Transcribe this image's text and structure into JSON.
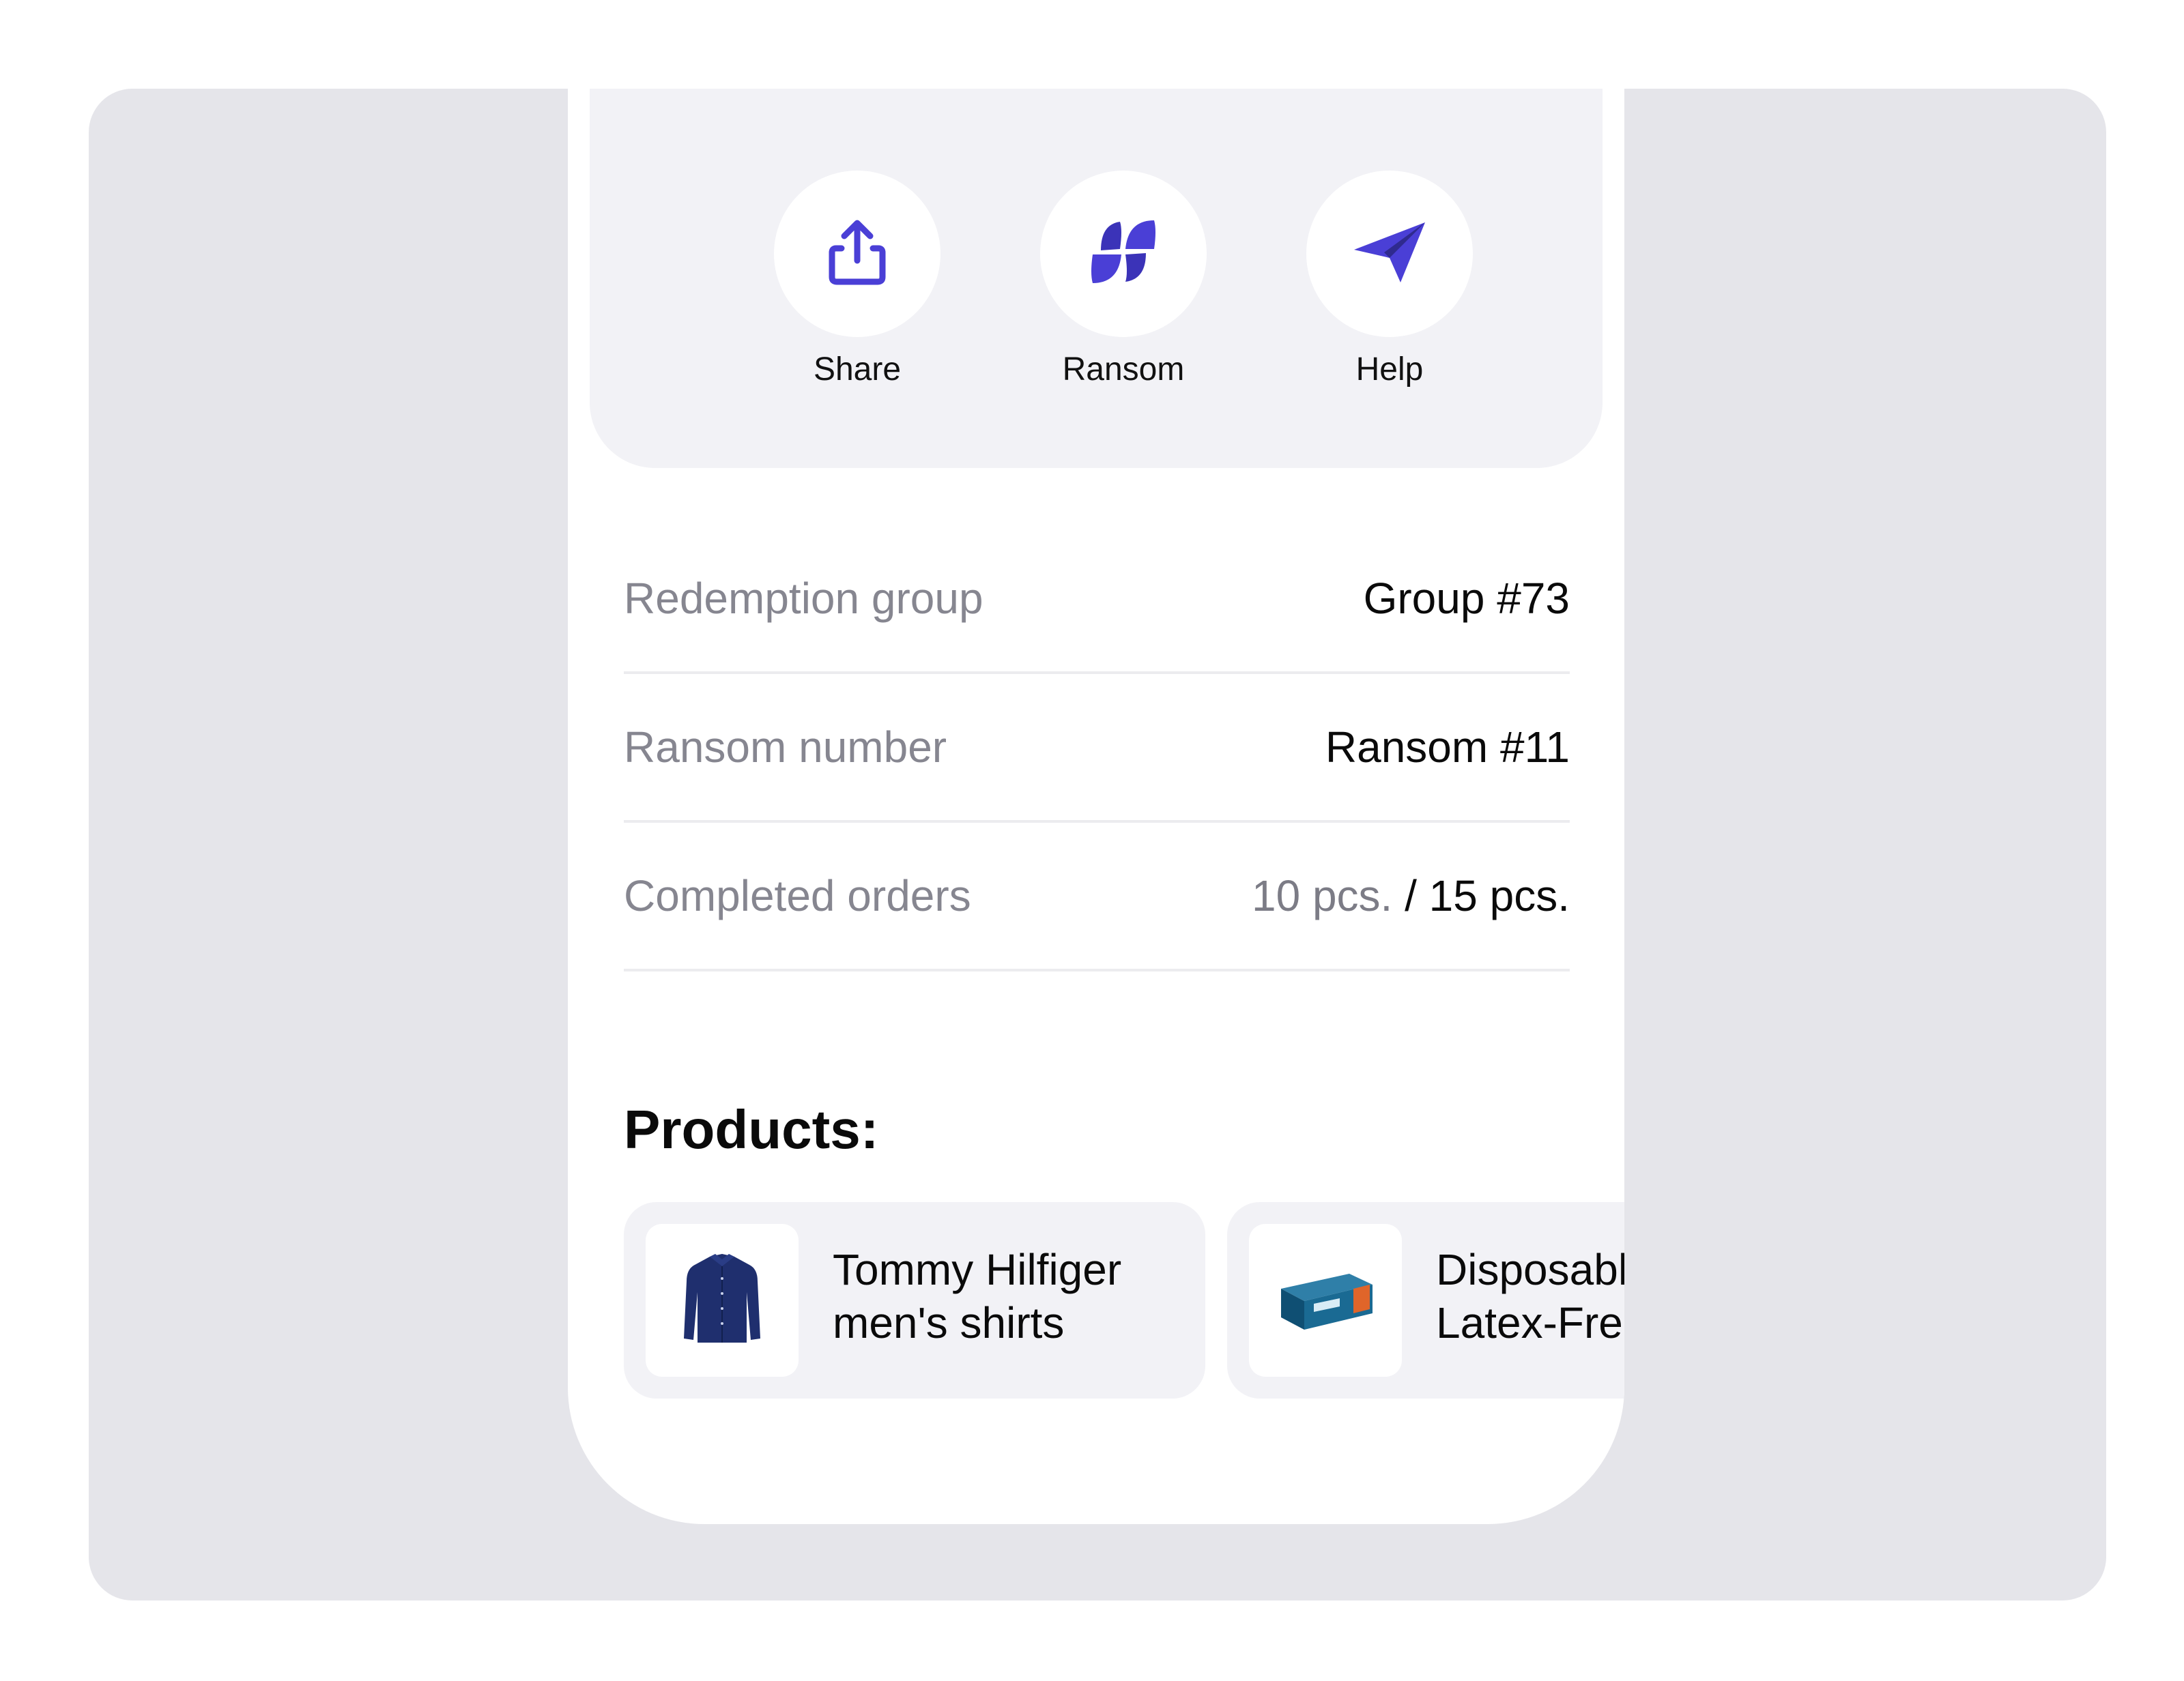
{
  "actions": [
    {
      "label": "Share",
      "icon": "share-icon"
    },
    {
      "label": "Ransom",
      "icon": "ransom-leaf-icon"
    },
    {
      "label": "Help",
      "icon": "paper-plane-icon"
    }
  ],
  "details": {
    "redemption_group": {
      "label": "Redemption group",
      "value": "Group #73"
    },
    "ransom_number": {
      "label": "Ransom number",
      "value": "Ransom #11"
    },
    "completed_orders": {
      "label": "Completed orders",
      "done": "10 pcs.",
      "separator": " / ",
      "total": "15 pcs."
    }
  },
  "products": {
    "title": "Products:",
    "items": [
      {
        "name": "Tommy Hilfiger\nmen's shirts",
        "image": "shirt-icon"
      },
      {
        "name": "Disposable\nLatex-Free",
        "image": "gloves-box-icon"
      }
    ]
  },
  "colors": {
    "accent": "#4a3fd6",
    "accent_dark": "#2f2a8f",
    "panel": "#f2f2f6",
    "backdrop": "#e5e5ea"
  }
}
